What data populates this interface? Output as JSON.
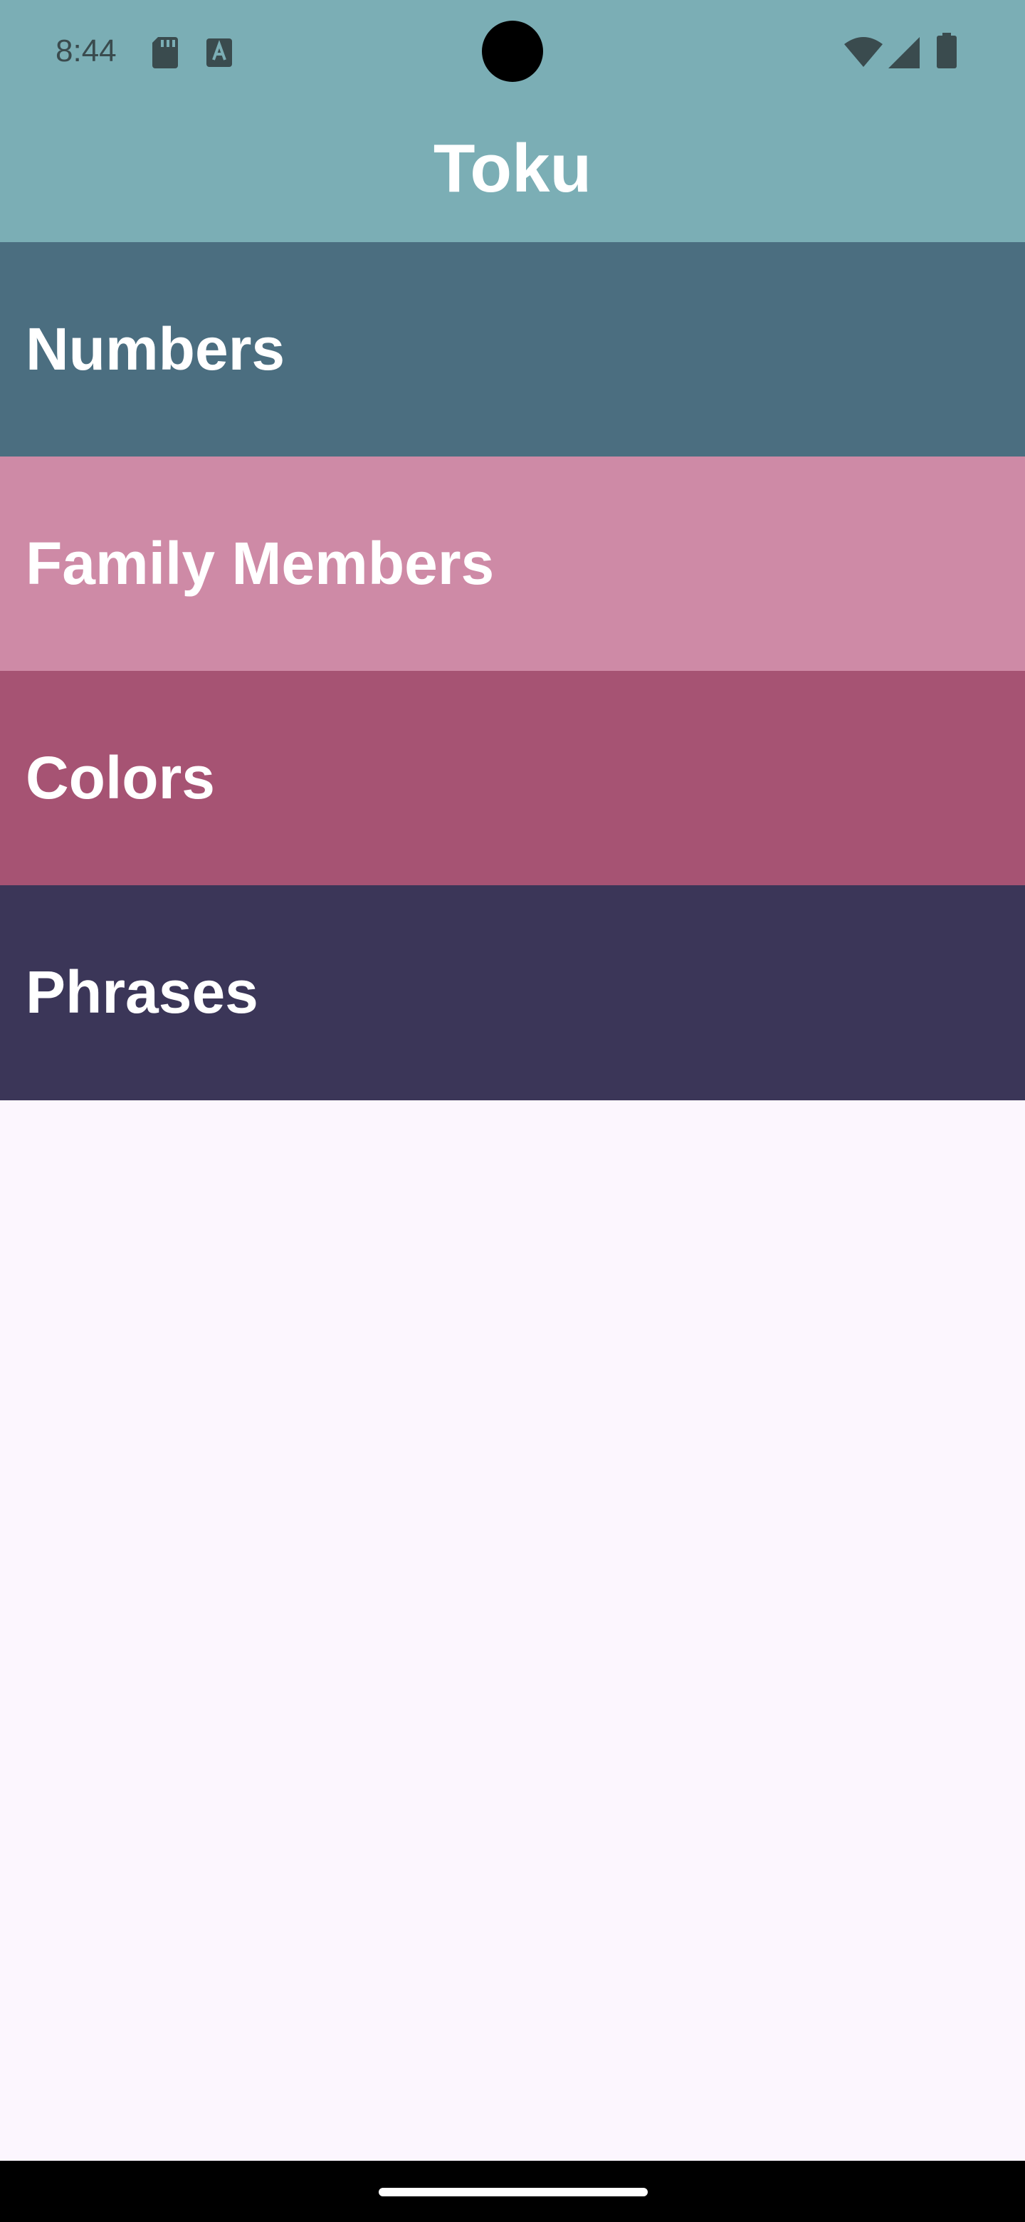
{
  "status_bar": {
    "time": "8:44",
    "icons": [
      "sd-card-icon",
      "text-recognition-icon",
      "wifi-icon",
      "cellular-signal-icon",
      "battery-icon"
    ]
  },
  "app_bar": {
    "title": "Toku"
  },
  "categories": [
    {
      "label": "Numbers",
      "color": "#4B6E80"
    },
    {
      "label": "Family Members",
      "color": "#CE8AA6"
    },
    {
      "label": "Colors",
      "color": "#A65373"
    },
    {
      "label": "Phrases",
      "color": "#3B3658"
    }
  ],
  "colors": {
    "app_bar": "#7BAEB5",
    "background": "#FCF6FE",
    "nav_bar": "#000000"
  }
}
